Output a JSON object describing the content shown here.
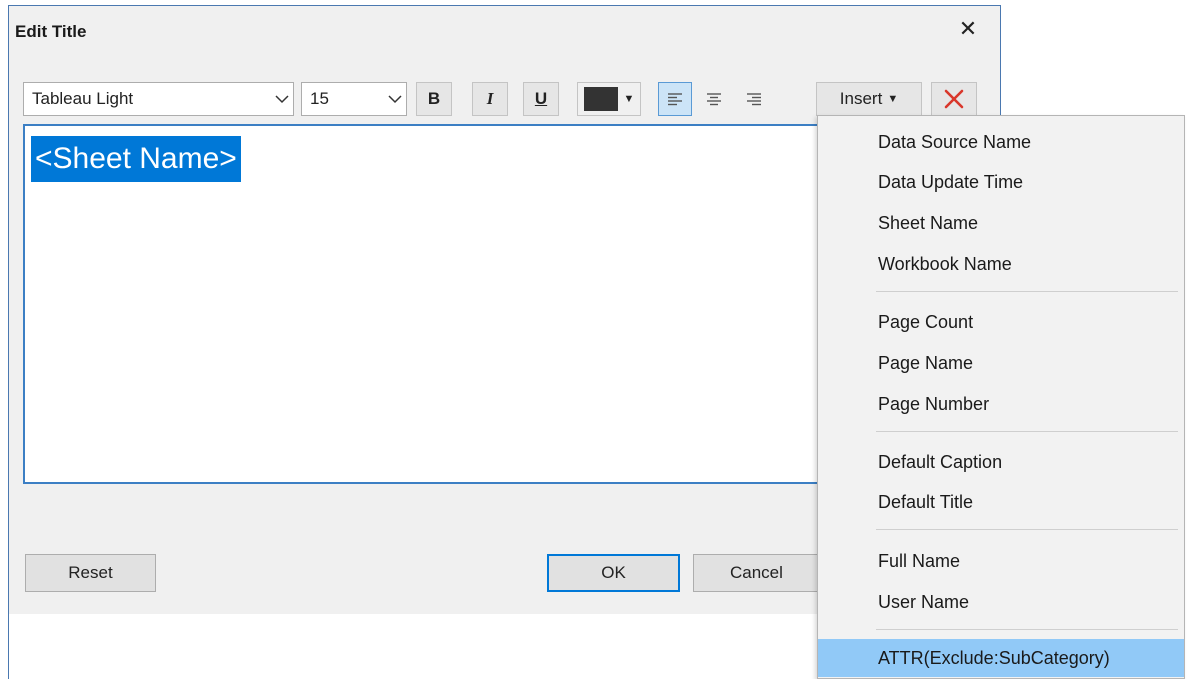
{
  "dialog": {
    "title": "Edit Title",
    "close_icon": "close-x-icon"
  },
  "toolbar": {
    "font_family": "Tableau Light",
    "font_size": "15",
    "bold_label": "B",
    "italic_label": "I",
    "underline_label": "U",
    "text_color": "#333333",
    "align": "left",
    "insert_label": "Insert",
    "clear_icon": "red-x-icon"
  },
  "editor": {
    "content": "<Sheet Name>"
  },
  "buttons": {
    "reset": "Reset",
    "ok": "OK",
    "cancel": "Cancel"
  },
  "insert_menu": {
    "groups": [
      [
        "Data Source Name",
        "Data Update Time",
        "Sheet Name",
        "Workbook Name"
      ],
      [
        "Page Count",
        "Page Name",
        "Page Number"
      ],
      [
        "Default Caption",
        "Default Title"
      ],
      [
        "Full Name",
        "User Name"
      ],
      [
        "ATTR(Exclude:SubCategory)"
      ]
    ],
    "highlighted": "ATTR(Exclude:SubCategory)"
  },
  "colors": {
    "accent": "#0078d7",
    "menu_highlight": "#91c9f7",
    "clear_red": "#d9372b"
  }
}
